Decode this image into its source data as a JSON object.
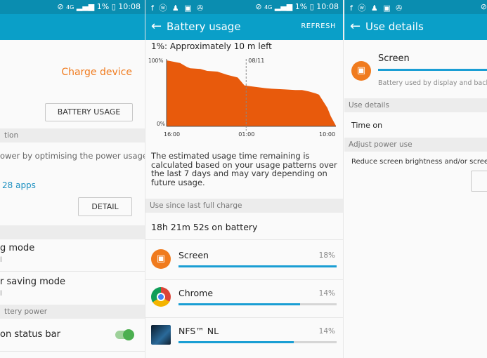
{
  "status": {
    "time": "10:08",
    "battery": "1%",
    "network": "4G",
    "notif_icons": "f ⓦ ♟ ▣ ✇"
  },
  "left": {
    "charge_device": "Charge device",
    "battery_usage_btn": "BATTERY USAGE",
    "section_optimization": "tion",
    "optim_desc": "ower by optimising the power usage",
    "apps_link": "28 apps",
    "detail_btn": "DETAIL",
    "mode1": "g mode",
    "mode1_sub": "l",
    "mode2": "r saving mode",
    "mode2_sub": "l",
    "section_battery_power": "ttery power",
    "status_bar_label": "on status bar"
  },
  "mid": {
    "title": "Battery usage",
    "refresh": "REFRESH",
    "remaining": "1%: Approximately 10 m left",
    "description": "The estimated usage time remaining is calculated based on your usage patterns over the last 7 days and may vary depending on future usage.",
    "section_usage": "Use since last full charge",
    "on_battery": "18h 21m 52s on battery",
    "apps": [
      {
        "name": "Screen",
        "percent": "18%",
        "fraction": 1.0,
        "icon": "screen-icon",
        "color": "#f07b1e"
      },
      {
        "name": "Chrome",
        "percent": "14%",
        "fraction": 0.77,
        "icon": "chrome-icon",
        "color": "#db4437"
      },
      {
        "name": "NFS™ NL",
        "percent": "14%",
        "fraction": 0.73,
        "icon": "nfs-game-icon",
        "color": "#1a3a5a"
      }
    ]
  },
  "right": {
    "title": "Use details",
    "screen_name": "Screen",
    "screen_desc": "Battery used by display and back",
    "section_use_details": "Use details",
    "time_on": "Time on",
    "section_adjust": "Adjust power use",
    "reduce_desc": "Reduce screen brightness and/or screen"
  },
  "chart_data": {
    "type": "area",
    "title": "",
    "xlabel": "",
    "ylabel": "",
    "y_tick_labels": [
      "100%",
      "0%"
    ],
    "x_tick_labels": [
      "16:00",
      "01:00",
      "10:00"
    ],
    "marker_label": "08/11",
    "x": [
      0,
      0.08,
      0.12,
      0.14,
      0.2,
      0.24,
      0.3,
      0.36,
      0.42,
      0.46,
      0.52,
      0.58,
      0.62,
      0.7,
      0.76,
      0.8,
      0.84,
      0.88,
      0.9,
      0.92,
      0.95,
      0.97,
      1.0
    ],
    "values": [
      100,
      96,
      90,
      88,
      87,
      84,
      83,
      78,
      74,
      62,
      60,
      58,
      57,
      56,
      55,
      55,
      53,
      50,
      48,
      40,
      28,
      15,
      1
    ],
    "ylim": [
      0,
      100
    ],
    "colors": {
      "fill": "#e85a0c",
      "axis": "#555555",
      "marker": "#888888"
    }
  }
}
